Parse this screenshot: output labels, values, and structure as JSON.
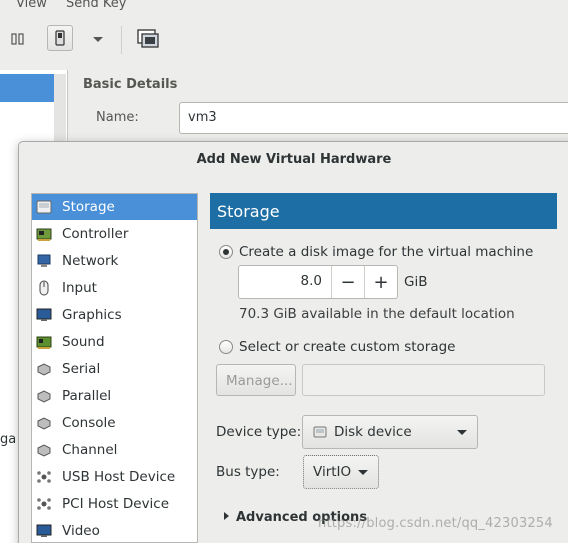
{
  "menubar": {
    "items": [
      "View",
      "Send Key"
    ]
  },
  "toolbar": {
    "icons": [
      "pause-icon",
      "power-icon",
      "dropdown-icon",
      "fullscreen-icon"
    ]
  },
  "left_panel": {
    "partial_text": "ga"
  },
  "details": {
    "section_title": "Basic Details",
    "name_label": "Name:",
    "name_value": "vm3"
  },
  "dialog": {
    "title": "Add New Virtual Hardware",
    "hardware_list": [
      {
        "label": "Storage",
        "icon": "storage-icon"
      },
      {
        "label": "Controller",
        "icon": "controller-icon"
      },
      {
        "label": "Network",
        "icon": "network-icon"
      },
      {
        "label": "Input",
        "icon": "mouse-icon"
      },
      {
        "label": "Graphics",
        "icon": "monitor-icon"
      },
      {
        "label": "Sound",
        "icon": "sound-card-icon"
      },
      {
        "label": "Serial",
        "icon": "serial-icon"
      },
      {
        "label": "Parallel",
        "icon": "parallel-icon"
      },
      {
        "label": "Console",
        "icon": "console-icon"
      },
      {
        "label": "Channel",
        "icon": "channel-icon"
      },
      {
        "label": "USB Host Device",
        "icon": "usb-icon"
      },
      {
        "label": "PCI Host Device",
        "icon": "pci-icon"
      },
      {
        "label": "Video",
        "icon": "video-icon"
      }
    ],
    "selected_index": 0,
    "panel_header": "Storage",
    "create_disk_label": "Create a disk image for the virtual machine",
    "disk_size": "8.0",
    "disk_unit": "GiB",
    "minus_label": "−",
    "plus_label": "+",
    "available_text": "70.3 GiB available in the default location",
    "custom_storage_label": "Select or create custom storage",
    "manage_button": "Manage...",
    "custom_path_value": "",
    "device_type_label": "Device type:",
    "device_type_value": "Disk device",
    "bus_type_label": "Bus type:",
    "bus_type_value": "VirtIO",
    "advanced_label": "Advanced options",
    "colors": {
      "selection": "#4a90d9",
      "header": "#1c6ea4"
    }
  },
  "watermark": "https://blog.csdn.net/qq_42303254"
}
